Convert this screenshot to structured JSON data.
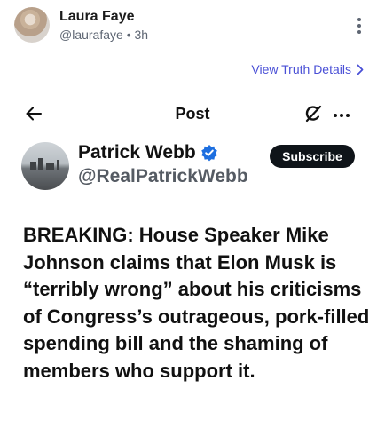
{
  "outer_post": {
    "author_name": "Laura Faye",
    "handle": "@laurafaye",
    "separator": "•",
    "time": "3h",
    "avatar_icon": "user-avatar",
    "more_icon": "more-vertical-icon"
  },
  "truth_link": {
    "label": "View Truth Details",
    "icon": "chevron-right-icon",
    "color": "#4a50d6"
  },
  "embedded": {
    "nav": {
      "title": "Post",
      "back_icon": "back-arrow-icon",
      "grok_icon": "grok-icon",
      "more_icon": "more-horizontal-icon"
    },
    "author": {
      "name": "Patrick Webb",
      "handle": "@RealPatrickWebb",
      "verified_icon": "verified-badge-icon",
      "verified_color": "#1d6fe0",
      "subscribe_label": "Subscribe"
    },
    "text": "BREAKING: House Speaker Mike Johnson claims that Elon Musk is “terribly wrong” about his criticisms of Congress’s outrageous, pork-filled spending bill and the shaming of members who support it."
  }
}
